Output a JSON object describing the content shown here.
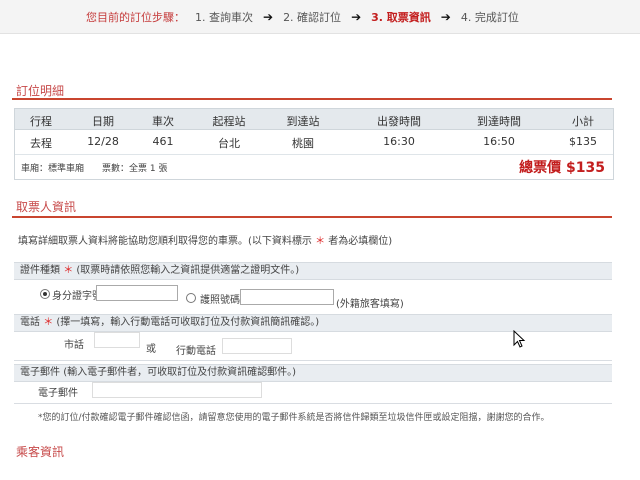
{
  "steps": {
    "label": "您目前的訂位步驟：",
    "items": [
      "1. 查詢車次",
      "2. 確認訂位",
      "3. 取票資訊",
      "4. 完成訂位"
    ],
    "active_index": 2
  },
  "order_section": {
    "title": "訂位明細"
  },
  "table": {
    "headers": [
      "行程",
      "日期",
      "車次",
      "起程站",
      "到達站",
      "出發時間",
      "到達時間",
      "小計"
    ],
    "row": [
      "去程",
      "12/28",
      "461",
      "台北",
      "桃園",
      "16:30",
      "16:50",
      "$135"
    ],
    "footer_left": "車廂：標準車廂　　票數：全票 1 張",
    "total_label": "總票價",
    "total_value": "$135"
  },
  "ticket_section": {
    "title": "取票人資訊",
    "note": "填寫詳細取票人資料將能協助您順利取得您的車票。(以下資料標示",
    "note_star": "＊",
    "note_tail": "者為必填欄位)"
  },
  "id_type": {
    "label": "證件種類",
    "star": "＊",
    "desc": "(取票時請依照您輸入之資訊提供適當之證明文件。)",
    "option1": "身分證字號",
    "option2": "護照號碼",
    "option2_hint": "(外籍旅客填寫)"
  },
  "phone": {
    "label": "電話",
    "star": "＊",
    "desc": "(擇一填寫，輸入行動電話可收取訂位及付款資訊簡訊確認。)",
    "home_label": "市話",
    "or_label": "或",
    "mobile_label": "行動電話"
  },
  "email": {
    "label": "電子郵件",
    "desc": "(輸入電子郵件者，可收取訂位及付款資訊確認郵件。)",
    "field_label": "電子郵件",
    "notice": "*您的訂位/付款確認電子郵件確認信函，請留意您使用的電子郵件系統是否將信件歸類至垃圾信件匣或設定阻擋，謝謝您的合作。"
  },
  "bottom_section": {
    "title": "乘客資訊"
  },
  "colors": {
    "accent": "#c31e1e",
    "band": "#e9edf1"
  }
}
